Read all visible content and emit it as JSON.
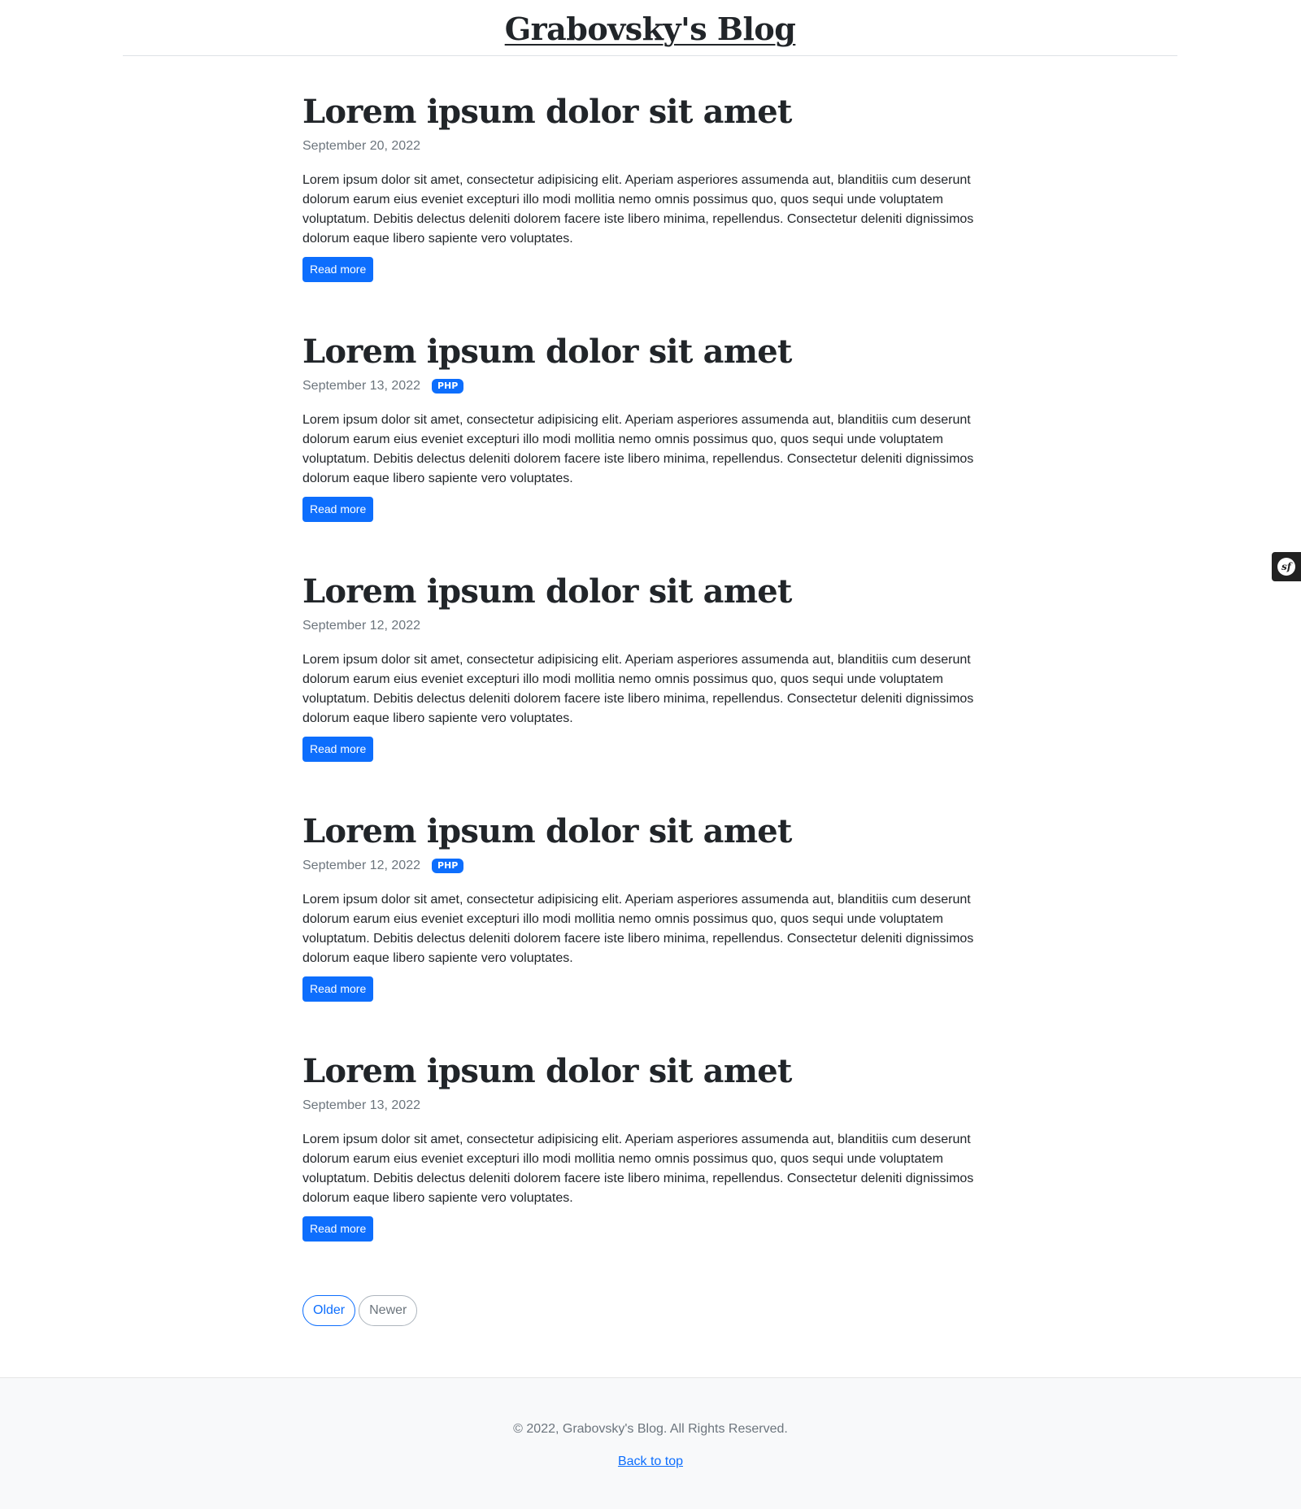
{
  "header": {
    "site_title": "Grabovsky's Blog"
  },
  "posts": [
    {
      "title": "Lorem ipsum dolor sit amet",
      "date": "September 20, 2022",
      "tag": "",
      "excerpt": "Lorem ipsum dolor sit amet, consectetur adipisicing elit. Aperiam asperiores assumenda aut, blanditiis cum deserunt dolorum earum eius eveniet excepturi illo modi mollitia nemo omnis possimus quo, quos sequi unde voluptatem voluptatum. Debitis delectus deleniti dolorem facere iste libero minima, repellendus. Consectetur deleniti dignissimos dolorum eaque libero sapiente vero voluptates.",
      "read_more": "Read more"
    },
    {
      "title": "Lorem ipsum dolor sit amet",
      "date": "September 13, 2022",
      "tag": "PHP",
      "excerpt": "Lorem ipsum dolor sit amet, consectetur adipisicing elit. Aperiam asperiores assumenda aut, blanditiis cum deserunt dolorum earum eius eveniet excepturi illo modi mollitia nemo omnis possimus quo, quos sequi unde voluptatem voluptatum. Debitis delectus deleniti dolorem facere iste libero minima, repellendus. Consectetur deleniti dignissimos dolorum eaque libero sapiente vero voluptates.",
      "read_more": "Read more"
    },
    {
      "title": "Lorem ipsum dolor sit amet",
      "date": "September 12, 2022",
      "tag": "",
      "excerpt": "Lorem ipsum dolor sit amet, consectetur adipisicing elit. Aperiam asperiores assumenda aut, blanditiis cum deserunt dolorum earum eius eveniet excepturi illo modi mollitia nemo omnis possimus quo, quos sequi unde voluptatem voluptatum. Debitis delectus deleniti dolorem facere iste libero minima, repellendus. Consectetur deleniti dignissimos dolorum eaque libero sapiente vero voluptates.",
      "read_more": "Read more"
    },
    {
      "title": "Lorem ipsum dolor sit amet",
      "date": "September 12, 2022",
      "tag": "PHP",
      "excerpt": "Lorem ipsum dolor sit amet, consectetur adipisicing elit. Aperiam asperiores assumenda aut, blanditiis cum deserunt dolorum earum eius eveniet excepturi illo modi mollitia nemo omnis possimus quo, quos sequi unde voluptatem voluptatum. Debitis delectus deleniti dolorem facere iste libero minima, repellendus. Consectetur deleniti dignissimos dolorum eaque libero sapiente vero voluptates.",
      "read_more": "Read more"
    },
    {
      "title": "Lorem ipsum dolor sit amet",
      "date": "September 13, 2022",
      "tag": "",
      "excerpt": "Lorem ipsum dolor sit amet, consectetur adipisicing elit. Aperiam asperiores assumenda aut, blanditiis cum deserunt dolorum earum eius eveniet excepturi illo modi mollitia nemo omnis possimus quo, quos sequi unde voluptatem voluptatum. Debitis delectus deleniti dolorem facere iste libero minima, repellendus. Consectetur deleniti dignissimos dolorum eaque libero sapiente vero voluptates.",
      "read_more": "Read more"
    }
  ],
  "pagination": {
    "older": "Older",
    "newer": "Newer"
  },
  "footer": {
    "copyright": "© 2022, Grabovsky's Blog. All Rights Reserved.",
    "back_to_top": "Back to top"
  },
  "debug_toolbar": {
    "icon": "symfony-logo-icon",
    "logo_text": "sf"
  },
  "colors": {
    "accent": "#0d6efd",
    "text": "#212529",
    "muted": "#6c757d",
    "footer_bg": "#f8f9fa"
  }
}
